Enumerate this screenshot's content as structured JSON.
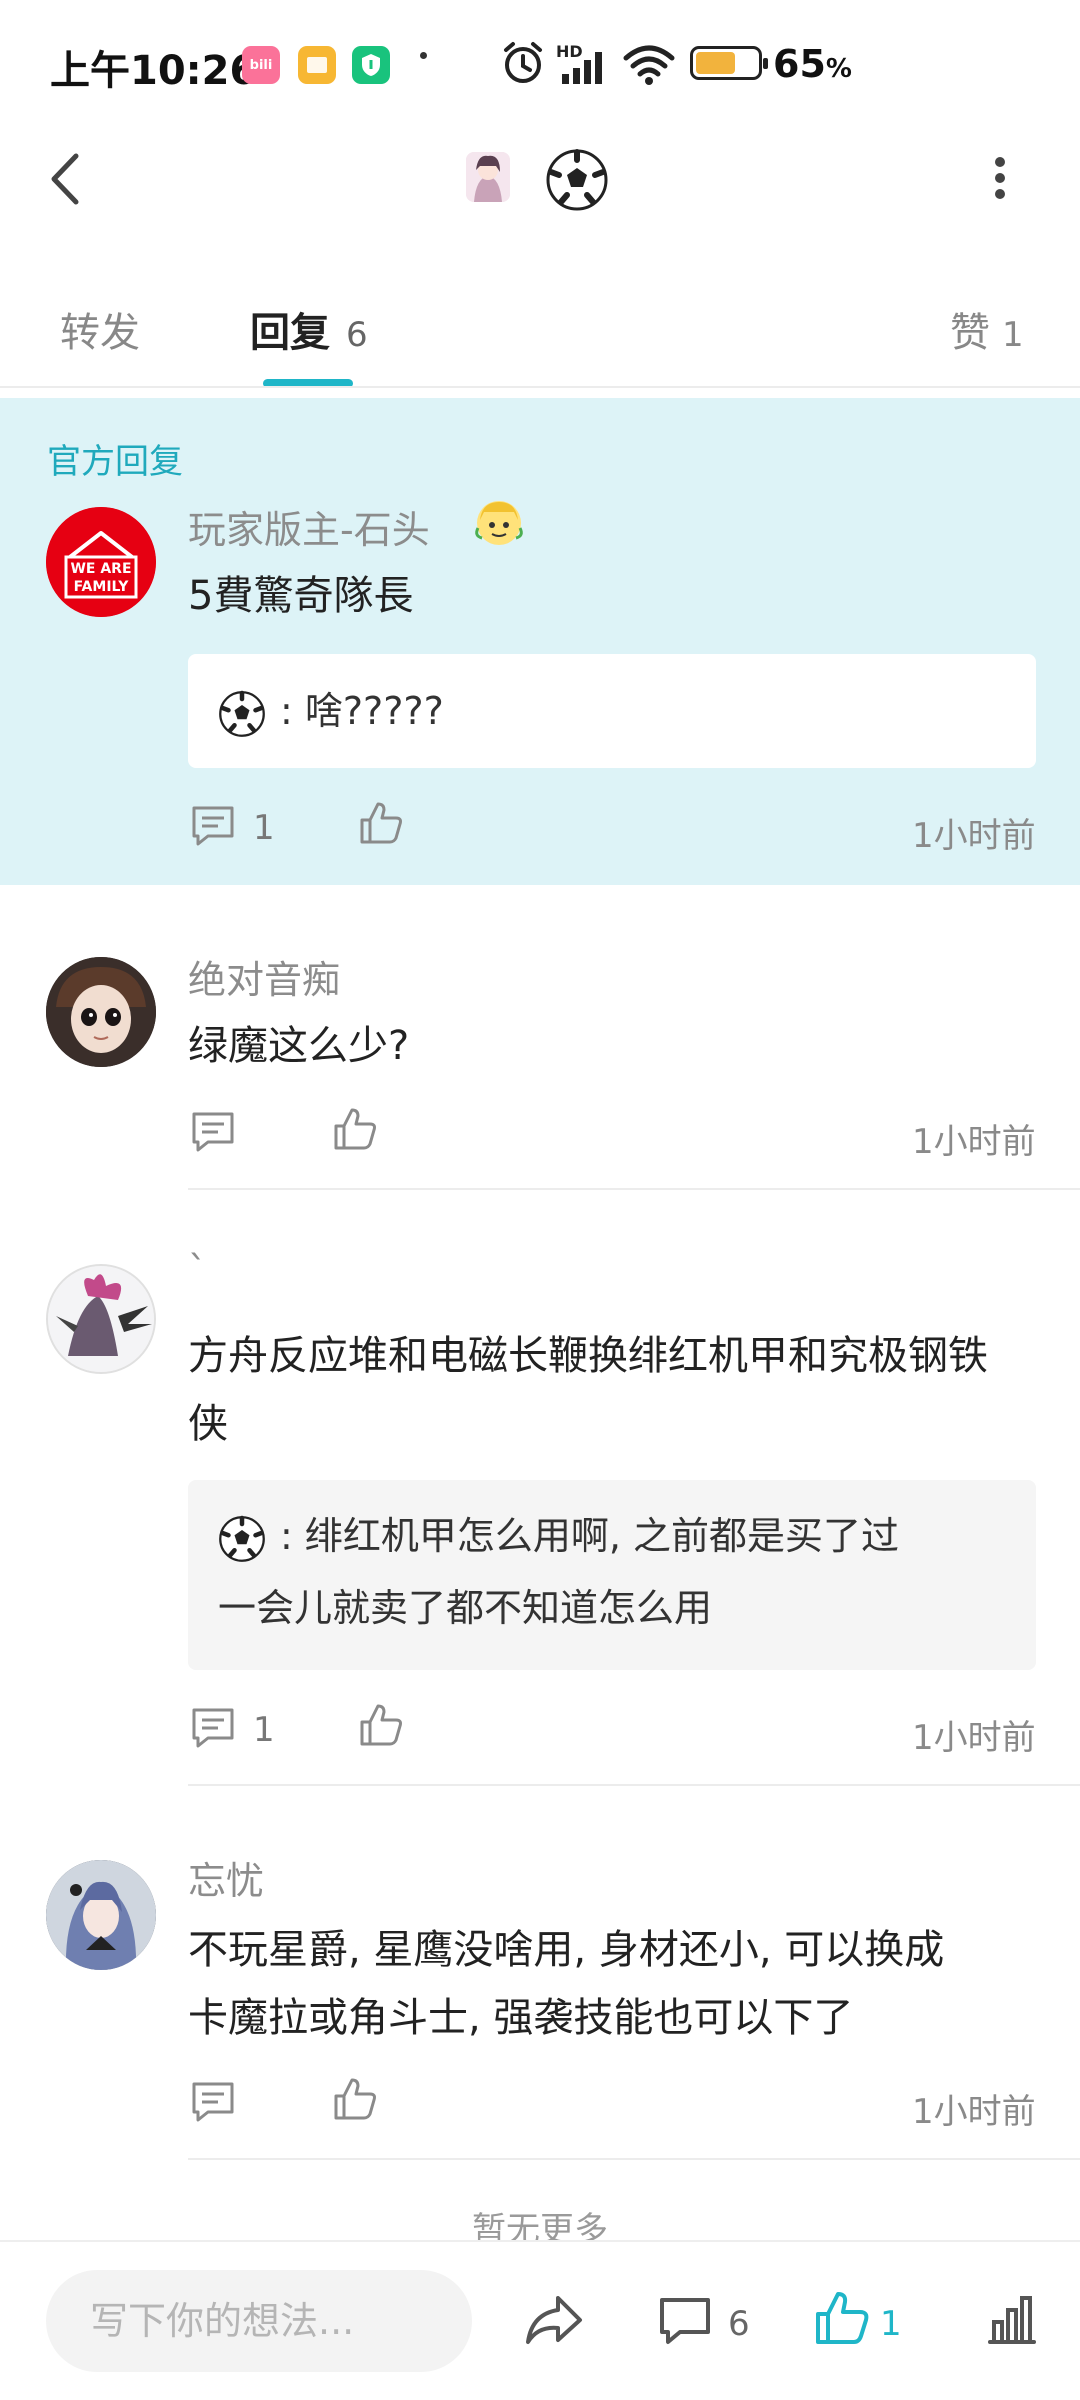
{
  "status_bar": {
    "time": "上午10:26",
    "apps": [
      {
        "name": "bilibili-app-icon",
        "label": "bili",
        "color": "#fb7299"
      },
      {
        "name": "notes-app-icon",
        "label": "",
        "color": "#f7b733"
      },
      {
        "name": "shield-app-icon",
        "label": "",
        "color": "#19c37d"
      }
    ],
    "network": "HD",
    "battery_percent": "65",
    "battery_unit": "%",
    "battery_level": 0.65
  },
  "tabs": {
    "forward": "转发",
    "reply": "回复",
    "reply_count": "6",
    "like": "赞",
    "like_count": "1"
  },
  "official": {
    "section_label": "官方回复",
    "username": "玩家版主-石头",
    "avatar_text_line1": "WE ARE",
    "avatar_text_line2": "FAMILY",
    "content": "5費驚奇隊長",
    "quote_prefix": ": ",
    "quote_text": "啥?????",
    "reply_count": "1",
    "time": "1小时前"
  },
  "comments": [
    {
      "username": "绝对音痴",
      "content": "绿魔这么少?",
      "time": "1小时前"
    },
    {
      "username": "`",
      "content_line1": "方舟反应堆和电磁长鞭换绯红机甲和究极钢铁",
      "content_line2": "侠",
      "quote_line1": ": 绯红机甲怎么用啊, 之前都是买了过",
      "quote_line2": "一会儿就卖了都不知道怎么用",
      "reply_count": "1",
      "time": "1小时前"
    },
    {
      "username": "忘忧",
      "content_line1": "不玩星爵, 星鹰没啥用, 身材还小, 可以换成",
      "content_line2": "卡魔拉或角斗士, 强袭技能也可以下了",
      "time": "1小时前"
    }
  ],
  "no_more": "暂无更多",
  "bottom_bar": {
    "placeholder": "写下你的想法...",
    "comment_count": "6",
    "like_count": "1",
    "accent_color": "#1fb6c8"
  }
}
